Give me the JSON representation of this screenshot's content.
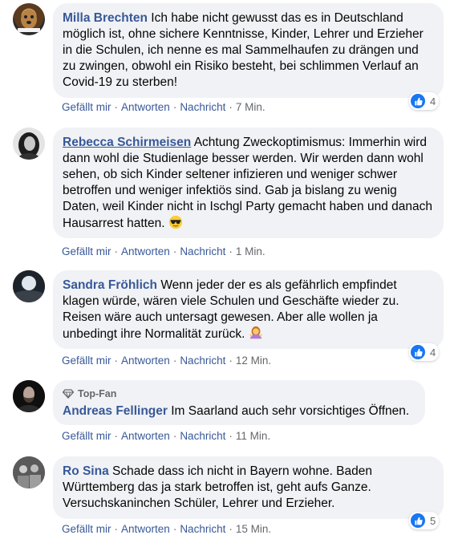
{
  "actions": {
    "like": "Gefällt mir",
    "reply": "Antworten",
    "message": "Nachricht",
    "separator": "·"
  },
  "comments": [
    {
      "author": "Milla Brechten",
      "text": "Ich habe nicht gewusst das es in Deutschland möglich ist, ohne sichere Kenntnisse, Kinder, Lehrer und Erzieher in die Schulen, ich nenne es mal Sammelhaufen zu drängen und zu zwingen, obwohl ein Risiko besteht, bei schlimmen Verlauf an Covid-19 zu sterben!",
      "time": "7 Min.",
      "reaction_count": "4"
    },
    {
      "author": "Rebecca Schirmeisen",
      "text": "Achtung Zweckoptimismus: Immerhin wird dann wohl die Studienlage besser werden. Wir werden dann wohl sehen, ob sich Kinder seltener infizieren und weniger schwer betroffen und weniger infektiös sind. Gab ja bislang zu wenig Daten, weil Kinder nicht in Ischgl Party gemacht haben und danach Hausarrest hatten.",
      "emoji": "sunglasses-emoji",
      "time": "1 Min."
    },
    {
      "author": "Sandra Fröhlich",
      "text": "Wenn jeder der es als gefährlich empfindet klagen würde, wären viele Schulen und Geschäfte wieder zu. Reisen wäre auch untersagt gewesen. Aber alle wollen ja unbedingt ihre Normalität zurück.",
      "emoji": "woman-shrugging-emoji",
      "time": "12 Min.",
      "reaction_count": "4"
    },
    {
      "badge": "Top-Fan",
      "author": "Andreas Fellinger",
      "text": "Im Saarland auch sehr vorsichtiges Öffnen.",
      "time": "11 Min."
    },
    {
      "author": "Ro Sina",
      "text": "Schade dass ich nicht in Bayern wohne. Baden Württemberg das ja stark betroffen ist, geht aufs Ganze. Versuchskaninchen Schüler, Lehrer und Erzieher.",
      "time": "15 Min.",
      "reaction_count": "5"
    }
  ],
  "colors": {
    "link": "#385898",
    "bubble": "#f0f2f5",
    "meta": "#65676b",
    "like": "#1877f2"
  }
}
